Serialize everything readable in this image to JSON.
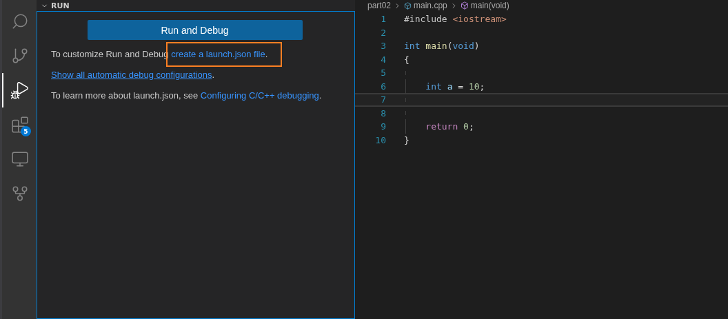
{
  "activity_bar": [
    {
      "selected": false
    },
    {
      "selected": false
    },
    {
      "selected": true
    },
    {
      "selected": false,
      "badge": "5"
    },
    {
      "selected": false
    },
    {
      "selected": false
    }
  ],
  "sidebar": {
    "section_title": "RUN",
    "button": "Run and Debug",
    "paragraphs": [
      [
        {
          "text": "To customize Run and Debug ",
          "kind": "plain"
        },
        {
          "text": "create a launch.json file",
          "kind": "link",
          "highlighted": true
        },
        {
          "text": ".",
          "kind": "plain"
        }
      ],
      [
        {
          "text": "Show all automatic debug configurations",
          "kind": "underlined-link"
        },
        {
          "text": ".",
          "kind": "plain"
        }
      ],
      [
        {
          "text": "To learn more about launch.json, see ",
          "kind": "plain"
        },
        {
          "text": "Configuring C/C++ debugging",
          "kind": "link"
        },
        {
          "text": ".",
          "kind": "plain"
        }
      ]
    ]
  },
  "editor": {
    "breadcrumbs": [
      {
        "text": "part02",
        "kind": "folder"
      },
      {
        "text": "main.cpp",
        "kind": "file"
      },
      {
        "text": "main(void)",
        "kind": "function"
      }
    ],
    "lines": [
      {
        "number": "1",
        "current": false,
        "tokens": [
          {
            "text": "#include ",
            "kind": "directive"
          },
          {
            "text": "<iostream>",
            "kind": "string"
          }
        ]
      },
      {
        "number": "2",
        "current": false
      },
      {
        "number": "3",
        "current": false,
        "tokens": [
          {
            "text": "int ",
            "kind": "keyword"
          },
          {
            "text": "main",
            "kind": "function"
          },
          {
            "text": "(",
            "kind": "punct"
          },
          {
            "text": "void",
            "kind": "keyword"
          },
          {
            "text": ")",
            "kind": "punct"
          }
        ]
      },
      {
        "number": "4",
        "current": false,
        "tokens": [
          {
            "text": "{",
            "kind": "punct"
          }
        ]
      },
      {
        "number": "5",
        "current": false,
        "indent": true
      },
      {
        "number": "6",
        "current": false,
        "indent": true,
        "tokens": [
          {
            "text": "    int ",
            "kind": "keyword"
          },
          {
            "text": "a",
            "kind": "variable"
          },
          {
            "text": " = ",
            "kind": "punct"
          },
          {
            "text": "10",
            "kind": "number"
          },
          {
            "text": ";",
            "kind": "punct"
          }
        ]
      },
      {
        "number": "7",
        "current": true,
        "indent": true
      },
      {
        "number": "8",
        "current": false,
        "indent": true
      },
      {
        "number": "9",
        "current": false,
        "indent": true,
        "tokens": [
          {
            "text": "    return ",
            "kind": "control"
          },
          {
            "text": "0",
            "kind": "number"
          },
          {
            "text": ";",
            "kind": "punct"
          }
        ]
      },
      {
        "number": "10",
        "current": false,
        "tokens": [
          {
            "text": "}",
            "kind": "punct"
          }
        ]
      }
    ]
  }
}
